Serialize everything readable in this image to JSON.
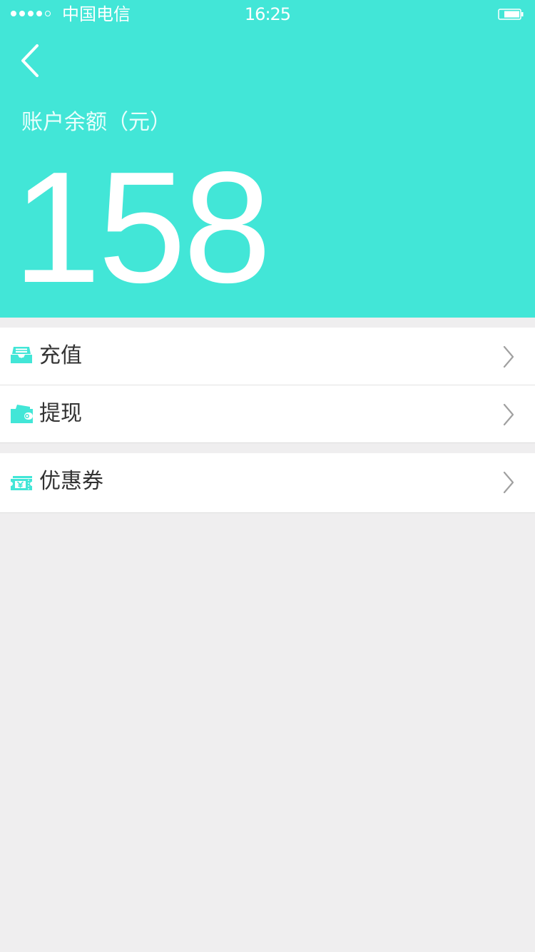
{
  "status_bar": {
    "carrier": "中国电信",
    "time": "16:25",
    "signal_dots_filled": 4,
    "signal_dots_total": 5,
    "battery_icon": "battery-icon"
  },
  "header": {
    "back_icon": "back-chevron-icon",
    "balance_label": "账户余额（元）",
    "balance_value": "158"
  },
  "menu": {
    "recharge": {
      "label": "充值",
      "icon": "inbox-tray-icon"
    },
    "withdraw": {
      "label": "提现",
      "icon": "wallet-icon"
    },
    "coupons": {
      "label": "优惠券",
      "icon": "coupon-ticket-icon"
    }
  },
  "colors": {
    "accent": "#42e6d7",
    "background": "#efeeef",
    "text": "#333333",
    "chevron": "#a0a0a0"
  }
}
